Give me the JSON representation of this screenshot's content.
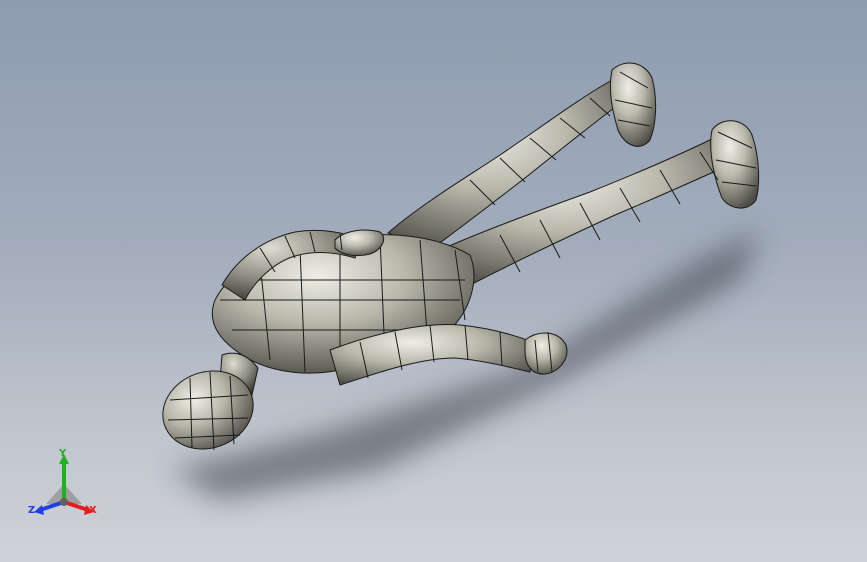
{
  "viewport": {
    "background_top": "#8e9cb0",
    "background_bottom": "#cfd2d6",
    "model": {
      "type": "mannequin-surface-model",
      "surface_color": "#b9b8ab",
      "mesh_color": "#1a1a1a"
    }
  },
  "triad": {
    "x_label": "X",
    "y_label": "Y",
    "z_label": "Z",
    "x_color": "#e02020",
    "y_color": "#20b020",
    "z_color": "#2040e0"
  }
}
